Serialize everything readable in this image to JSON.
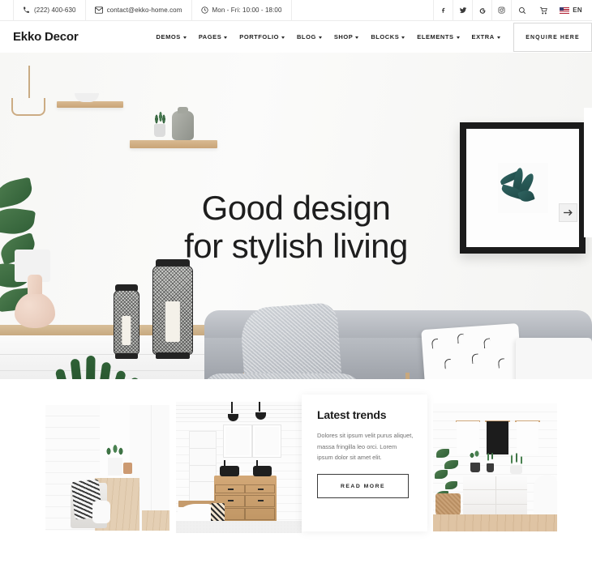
{
  "topbar": {
    "phone": "(222) 400-630",
    "email": "contact@ekko-home.com",
    "hours": "Mon - Fri: 10:00 - 18:00",
    "social": [
      {
        "name": "facebook-icon",
        "label": "f"
      },
      {
        "name": "twitter-icon",
        "label": "t"
      },
      {
        "name": "google-icon",
        "label": "G"
      },
      {
        "name": "instagram-icon",
        "label": "ig"
      }
    ],
    "search_label": "Search",
    "cart_label": "Cart",
    "language": "EN"
  },
  "nav": {
    "logo": "Ekko Decor",
    "items": [
      {
        "label": "DEMOS",
        "has_dropdown": true
      },
      {
        "label": "PAGES",
        "has_dropdown": true
      },
      {
        "label": "PORTFOLIO",
        "has_dropdown": true
      },
      {
        "label": "BLOG",
        "has_dropdown": true
      },
      {
        "label": "SHOP",
        "has_dropdown": true
      },
      {
        "label": "BLOCKS",
        "has_dropdown": true
      },
      {
        "label": "ELEMENTS",
        "has_dropdown": true
      },
      {
        "label": "EXTRA",
        "has_dropdown": true
      }
    ],
    "cta": "ENQUIRE HERE"
  },
  "hero": {
    "title_line1": "Good design",
    "title_line2": "for stylish living",
    "next_slide_label": "Next slide"
  },
  "trends": {
    "title": "Latest trends",
    "body": "Dolores sit ipsum velit purus aliquet, massa fringilla leo orci. Lorem ipsum dolor sit amet elit.",
    "button": "READ MORE",
    "cards": [
      {
        "name": "hallway-interior-photo"
      },
      {
        "name": "bathroom-vanity-photo"
      },
      {
        "name": "sideboard-artwork-photo"
      }
    ]
  },
  "colors": {
    "text_dark": "#1e1e1e",
    "text_muted": "#707070",
    "border": "#e0e0e0",
    "page_bg": "#ffffff"
  }
}
